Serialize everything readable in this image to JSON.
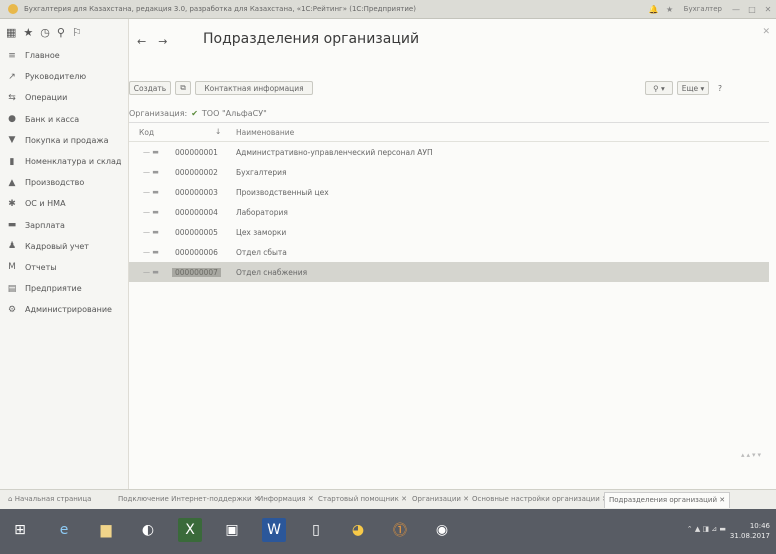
{
  "window": {
    "title": "Бухгалтерия для Казахстана, редакция 3.0, разработка для Казахстана, «1С:Рейтинг» (1С:Предприятие)",
    "user": "Бухгалтер"
  },
  "sidebar": {
    "items": [
      {
        "label": "Главное",
        "icon": "menu-icon"
      },
      {
        "label": "Руководителю",
        "icon": "chart-icon"
      },
      {
        "label": "Операции",
        "icon": "operations-icon"
      },
      {
        "label": "Банк и касса",
        "icon": "bank-icon"
      },
      {
        "label": "Покупка и продажа",
        "icon": "cart-icon"
      },
      {
        "label": "Номенклатура и склад",
        "icon": "warehouse-icon"
      },
      {
        "label": "Производство",
        "icon": "production-icon"
      },
      {
        "label": "ОС и НМА",
        "icon": "assets-icon"
      },
      {
        "label": "Зарплата",
        "icon": "salary-icon"
      },
      {
        "label": "Кадровый учет",
        "icon": "personnel-icon"
      },
      {
        "label": "Отчеты",
        "icon": "reports-icon"
      },
      {
        "label": "Предприятие",
        "icon": "enterprise-icon"
      },
      {
        "label": "Администрирование",
        "icon": "admin-icon"
      }
    ]
  },
  "main": {
    "title": "Подразделения организаций",
    "toolbar": {
      "create": "Создать",
      "contact_info": "Контактная информация",
      "more": "Еще",
      "help": "?"
    },
    "filter": {
      "label": "Организация:",
      "value": "ТОО \"АльфаСУ\""
    },
    "columns": {
      "code": "Код",
      "name": "Наименование"
    },
    "rows": [
      {
        "code": "000000001",
        "name": "Административно-управленческий персонал АУП"
      },
      {
        "code": "000000002",
        "name": "Бухгалтерия"
      },
      {
        "code": "000000003",
        "name": "Производственный цех"
      },
      {
        "code": "000000004",
        "name": "Лаборатория"
      },
      {
        "code": "000000005",
        "name": "Цех заморки"
      },
      {
        "code": "000000006",
        "name": "Отдел сбыта"
      },
      {
        "code": "000000007",
        "name": "Отдел снабжения"
      }
    ]
  },
  "tabs": {
    "home": "Начальная страница",
    "items": [
      "Подключение Интернет-поддержки",
      "Информация",
      "Стартовый помощник",
      "Организации",
      "Основные настройки организации",
      "Подразделения организаций"
    ]
  },
  "clock": {
    "time": "10:46",
    "date": "31.08.2017"
  }
}
